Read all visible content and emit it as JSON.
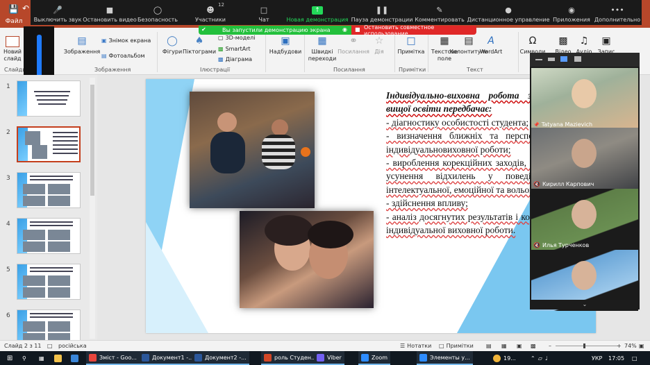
{
  "powerpoint": {
    "file_tab": "Файл",
    "ribbon": {
      "new_slide": "Новий слайд",
      "slides_group": "Слайди",
      "images_label": "Зображення",
      "screenshot_label": "Знімок екрана",
      "photoalbum_label": "Фотоальбом",
      "images_group": "Зображення",
      "shapes_label": "Фігури",
      "pictograms_label": "Піктограми",
      "models3d_label": "3D-моделі",
      "smartart_label": "SmartArt",
      "diagram_label": "Діаграма",
      "illustrations_group": "Ілюстрації",
      "addins_label": "Надбудови",
      "quicklinks_label": "Швидкі переходи",
      "links_label": "Посилання",
      "action_label": "Дія",
      "links_group": "Посилання",
      "note_label": "Примітка",
      "notes_group": "Примітки",
      "textfield_label": "Текстове поле",
      "headers_label": "Колонтитули",
      "wordart_label": "WordArt",
      "text_group": "Текст",
      "symbols_label": "Символи",
      "video_label": "Відео",
      "audio_label": "Аудіо",
      "recording_label": "Запис"
    },
    "slides": [
      {
        "num": "1"
      },
      {
        "num": "2"
      },
      {
        "num": "3"
      },
      {
        "num": "4"
      },
      {
        "num": "5"
      },
      {
        "num": "6"
      }
    ],
    "current_slide_text": {
      "heading": "Індивідуально-виховна робота зі здобувачами вищої освіти передбачає:",
      "lines": [
        "- діагностику особистості студента;",
        "- визначення ближніх та перспективних цілей індивідуальновиховної роботи;",
        "- вироблення корекційних заходів, спрямованих на усунення відхилень у поведінці, розвиток інтелектуальної, емоційної та вольової сфер;",
        "- здійснення впливу;",
        "- аналіз досягнутих результатів і корегування цілей індивідуальної виховної роботи."
      ]
    },
    "status": {
      "slide_counter": "Слайд 2 з 11",
      "language": "російська",
      "notes": "Нотатки",
      "comments": "Примітки",
      "zoom": "74%"
    }
  },
  "zoom": {
    "volume_level": "100",
    "volume_fraction": 1.0,
    "toolbar": {
      "mute": "Выключить звук",
      "stop_video": "Остановить видео",
      "security": "Безопасность",
      "participants": "Участники",
      "participants_count": "12",
      "chat": "Чат",
      "new_share": "Новая демонстрация",
      "pause_share": "Пауза демонстрации",
      "annotate": "Комментировать",
      "remote_control": "Дистанционное управление",
      "apps": "Приложения",
      "more": "Дополнительно"
    },
    "sharing_banner": "Вы запустили демонстрацию экрана",
    "stop_share": "Остановить совместное использование",
    "participants": [
      {
        "name": "Tatyana Mazievich",
        "muted": false
      },
      {
        "name": "Кирилл Карпович",
        "muted": true
      },
      {
        "name": "Илья Турченков",
        "muted": true
      },
      {
        "name": "",
        "muted": false
      }
    ]
  },
  "taskbar": {
    "items": [
      {
        "label": "Зміст - Goo..."
      },
      {
        "label": "Документ1 -..."
      },
      {
        "label": "Документ2 -..."
      },
      {
        "label": "роль Студен..."
      },
      {
        "label": "Viber"
      },
      {
        "label": "Zoom"
      },
      {
        "label": "Элементы у..."
      }
    ],
    "weather": "19...",
    "lang": "УКР",
    "time": "17:05"
  }
}
